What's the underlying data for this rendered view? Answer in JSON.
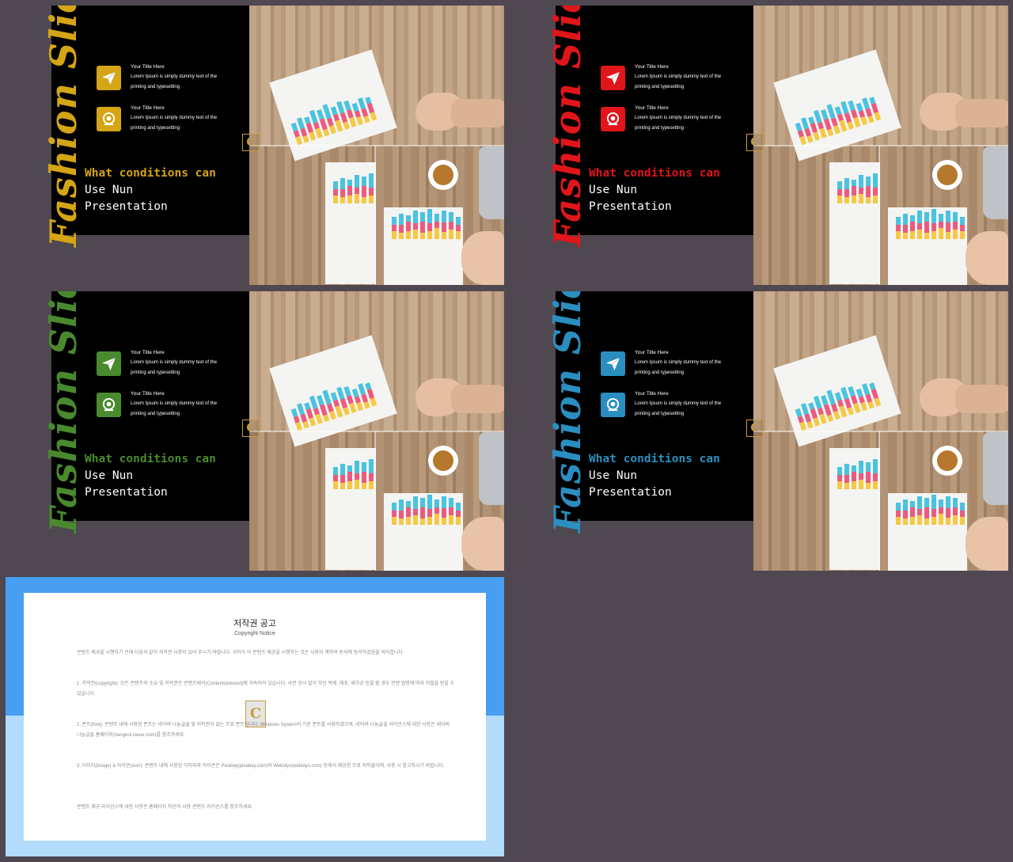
{
  "slides": [
    {
      "accent": "#d4a514",
      "script_title": "Fashion Slide",
      "items": [
        {
          "icon": "paper-plane-icon",
          "title": "Your Title Here",
          "desc": "Lorem Ipsum is simply dummy text of the printing and typesetting"
        },
        {
          "icon": "webcam-icon",
          "title": "Your Title Here",
          "desc": "Lorem Ipsum is simply dummy text of the printing and typesetting"
        }
      ],
      "headline": {
        "line1": "What conditions can",
        "line2": "Use Nun",
        "line3": "Presentation"
      }
    },
    {
      "accent": "#e0161b",
      "script_title": "Fashion Slide",
      "items": [
        {
          "icon": "paper-plane-icon",
          "title": "Your Title Here",
          "desc": "Lorem Ipsum is simply dummy text of the printing and typesetting"
        },
        {
          "icon": "webcam-icon",
          "title": "Your Title Here",
          "desc": "Lorem Ipsum is simply dummy text of the printing and typesetting"
        }
      ],
      "headline": {
        "line1": "What conditions can",
        "line2": "Use Nun",
        "line3": "Presentation"
      }
    },
    {
      "accent": "#4a8a2e",
      "script_title": "Fashion Slide",
      "items": [
        {
          "icon": "paper-plane-icon",
          "title": "Your Title Here",
          "desc": "Lorem Ipsum is simply dummy text of the printing and typesetting"
        },
        {
          "icon": "webcam-icon",
          "title": "Your Title Here",
          "desc": "Lorem Ipsum is simply dummy text of the printing and typesetting"
        }
      ],
      "headline": {
        "line1": "What conditions can",
        "line2": "Use Nun",
        "line3": "Presentation"
      }
    },
    {
      "accent": "#2a8fc0",
      "script_title": "Fashion Slide",
      "items": [
        {
          "icon": "paper-plane-icon",
          "title": "Your Title Here",
          "desc": "Lorem Ipsum is simply dummy text of the printing and typesetting"
        },
        {
          "icon": "webcam-icon",
          "title": "Your Title Here",
          "desc": "Lorem Ipsum is simply dummy text of the printing and typesetting"
        }
      ],
      "headline": {
        "line1": "What conditions can",
        "line2": "Use Nun",
        "line3": "Presentation"
      }
    }
  ],
  "badge_letter": "C",
  "notice": {
    "title": "저작권 공고",
    "subtitle": "Copyright Notice",
    "paragraphs": [
      "콘텐츠 제공을 시행하기 전에 다음과 같이 저작권 사항이 있어 주시기 바랍니다. 귀하가 이 콘텐츠 제공을 시행하는 것은 사용자 계약의 동의에 동의하셨음을 의미합니다.",
      "1. 저작권(copyright): 모든 콘텐츠의 소유 및 저작권은 콘텐츠베이(Contentstokeout)에 귀속되어 있습니다. 사전 승낙 없이 무단 복제, 배포, 재가공 등을 할 경우 관련 법령에 따라 처벌을 받을 수 있습니다.",
      "2. 폰트(font): 콘텐츠 내에 사용된 폰트는 네이버 나눔글꼴 및 저작권이 없는 무료 폰트입니다. Windows System의 기본 폰트를 사용하였으며, 네이버 나눔글꼴 라이선스에 대한 사항은 네이버 나눔글꼴 홈페이지(hangeul.naver.com)를 참조하세요.",
      "3. 이미지(image) & 아이콘(icon): 콘텐츠 내에 사용된 이미지와 아이콘은 Pixabay(pixabay.com)와 Webolys(webolys.com) 등에서 제공한 무료 저작물이며, 사용 시 참고하시기 바랍니다.",
      "콘텐츠 제공 라이선스에 대한 사항은 홈페이지 하단의 사용 콘텐츠 라이선스를 참조하세요."
    ]
  }
}
